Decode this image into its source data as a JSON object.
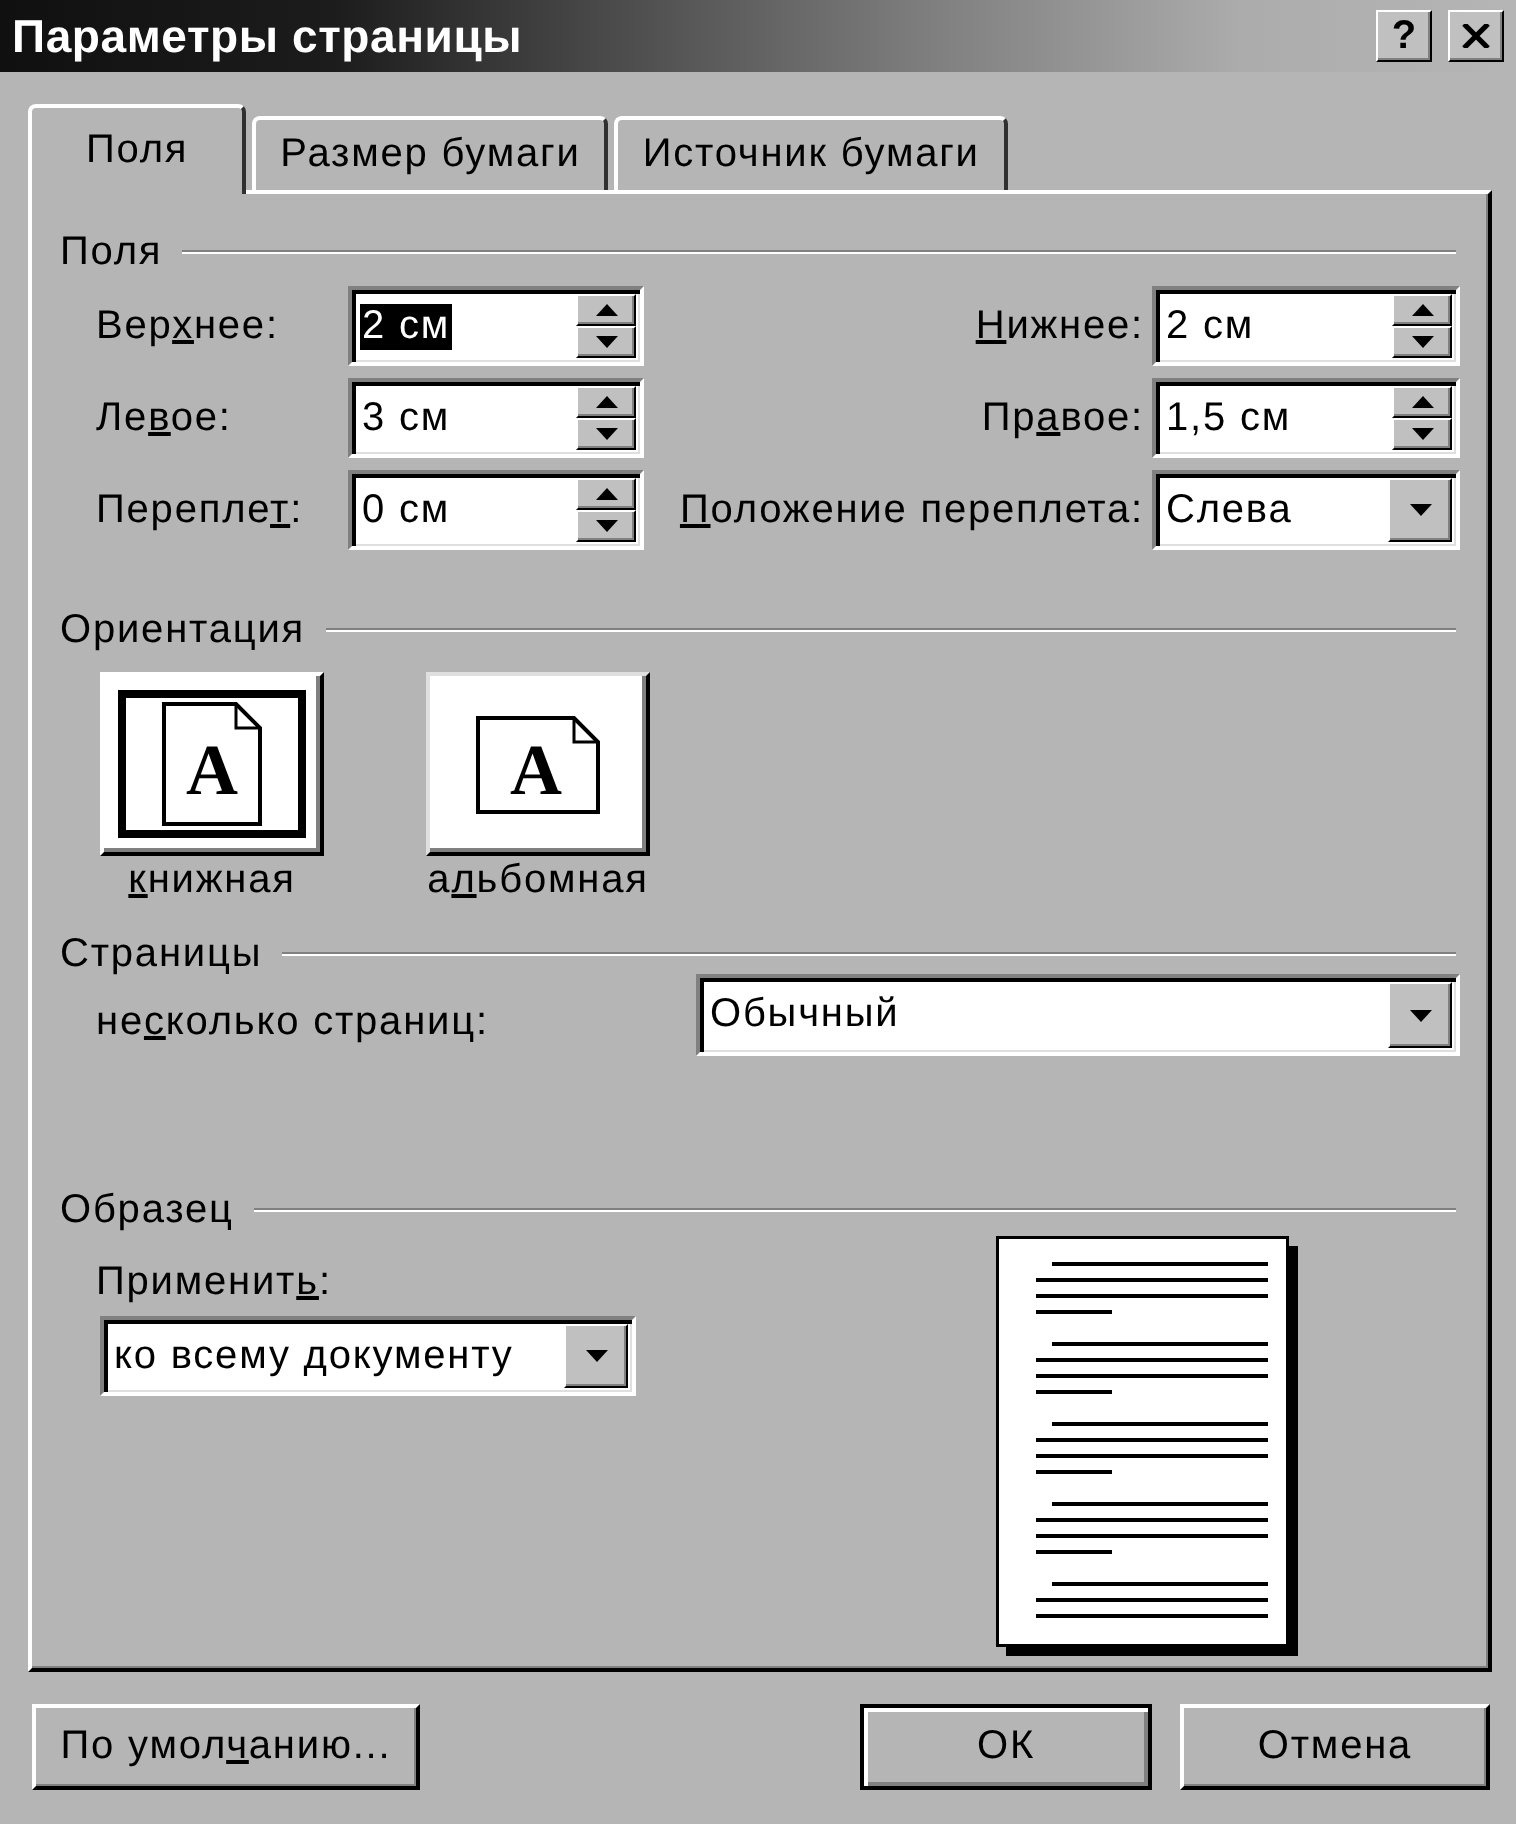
{
  "window": {
    "title": "Параметры страницы",
    "help_button": "?"
  },
  "tabs": [
    {
      "label": "Поля",
      "selected": true
    },
    {
      "label": "Размер бумаги",
      "selected": false
    },
    {
      "label": "Источник бумаги",
      "selected": false
    }
  ],
  "margins": {
    "heading": "Поля",
    "fields": [
      {
        "label": [
          {
            "text": "Вер",
            "underlined": false
          },
          {
            "text": "х",
            "underlined": true
          },
          {
            "text": "нее:",
            "underlined": false
          }
        ],
        "kind": "spin",
        "value": "2 см",
        "highlighted": true
      },
      {
        "label": [
          {
            "text": "Н",
            "underlined": true
          },
          {
            "text": "ижнее:",
            "underlined": false
          }
        ],
        "kind": "spin",
        "value": "2 см",
        "highlighted": false
      },
      {
        "label": [
          {
            "text": "Ле",
            "underlined": false
          },
          {
            "text": "в",
            "underlined": true
          },
          {
            "text": "ое:",
            "underlined": false
          }
        ],
        "kind": "spin",
        "value": "3 см",
        "highlighted": false
      },
      {
        "label": [
          {
            "text": "Пр",
            "underlined": false
          },
          {
            "text": "а",
            "underlined": true
          },
          {
            "text": "вое:",
            "underlined": false
          }
        ],
        "kind": "spin",
        "value": "1,5 см",
        "highlighted": false
      },
      {
        "label": [
          {
            "text": "Перепле",
            "underlined": false
          },
          {
            "text": "т",
            "underlined": true
          },
          {
            "text": ":",
            "underlined": false
          }
        ],
        "kind": "spin",
        "value": "0 см",
        "highlighted": false
      },
      {
        "label": [
          {
            "text": "П",
            "underlined": true
          },
          {
            "text": "оложение переплета:",
            "underlined": false
          }
        ],
        "kind": "dropdown",
        "value": "Слева",
        "highlighted": false
      }
    ]
  },
  "orientation": {
    "heading": "Ориентация",
    "options": [
      {
        "label": [
          {
            "text": "к",
            "underlined": true
          },
          {
            "text": "нижная",
            "underlined": false
          }
        ],
        "kind": "portrait",
        "glyph": "A",
        "selected": true
      },
      {
        "label": [
          {
            "text": "а",
            "underlined": false
          },
          {
            "text": "л",
            "underlined": true
          },
          {
            "text": "ьбомная",
            "underlined": false
          }
        ],
        "kind": "landscape",
        "glyph": "A",
        "selected": false
      }
    ]
  },
  "pages": {
    "heading": "Страницы",
    "label": [
      {
        "text": "не",
        "underlined": false
      },
      {
        "text": "с",
        "underlined": true
      },
      {
        "text": "колько страниц:",
        "underlined": false
      }
    ],
    "value": "Обычный"
  },
  "sample": {
    "heading": "Образец",
    "apply_label": [
      {
        "text": "Применит",
        "underlined": false
      },
      {
        "text": "ь",
        "underlined": true
      },
      {
        "text": ":",
        "underlined": false
      }
    ],
    "apply_value": "ко всему документу"
  },
  "buttons": [
    {
      "label": [
        {
          "text": "По умол",
          "underlined": false
        },
        {
          "text": "ч",
          "underlined": true
        },
        {
          "text": "анию...",
          "underlined": false
        }
      ],
      "default": false
    },
    {
      "label": [
        {
          "text": "ОК",
          "underlined": false
        }
      ],
      "default": true
    },
    {
      "label": [
        {
          "text": "Отмена",
          "underlined": false
        }
      ],
      "default": false
    }
  ]
}
